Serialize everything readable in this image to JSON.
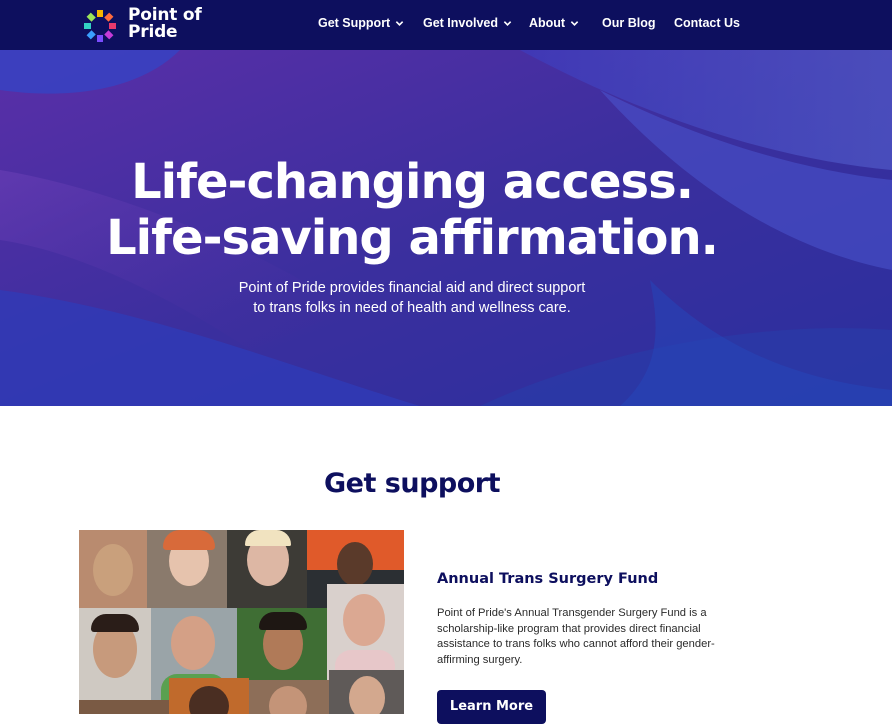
{
  "brand": {
    "name_line1": "Point of",
    "name_line2": "Pride"
  },
  "nav": {
    "items": [
      {
        "label": "Get Support",
        "dropdown": true
      },
      {
        "label": "Get Involved",
        "dropdown": true
      },
      {
        "label": "About",
        "dropdown": true
      },
      {
        "label": "Our Blog",
        "dropdown": false
      },
      {
        "label": "Contact Us",
        "dropdown": false
      }
    ]
  },
  "hero": {
    "title_line1": "Life-changing access.",
    "title_line2": "Life-saving affirmation.",
    "subtitle_line1": "Point of Pride provides financial aid and direct support",
    "subtitle_line2": "to trans folks in need of health and wellness care."
  },
  "support": {
    "heading": "Get support",
    "card": {
      "title": "Annual Trans Surgery Fund",
      "description": "Point of Pride's Annual Transgender Surgery Fund is a scholarship-like program that provides direct financial assistance to trans folks who cannot afford their gender-affirming surgery.",
      "button_label": "Learn More"
    }
  },
  "colors": {
    "navy": "#0d0f5e",
    "hero_purple": "#3a2a9c",
    "white": "#ffffff"
  }
}
